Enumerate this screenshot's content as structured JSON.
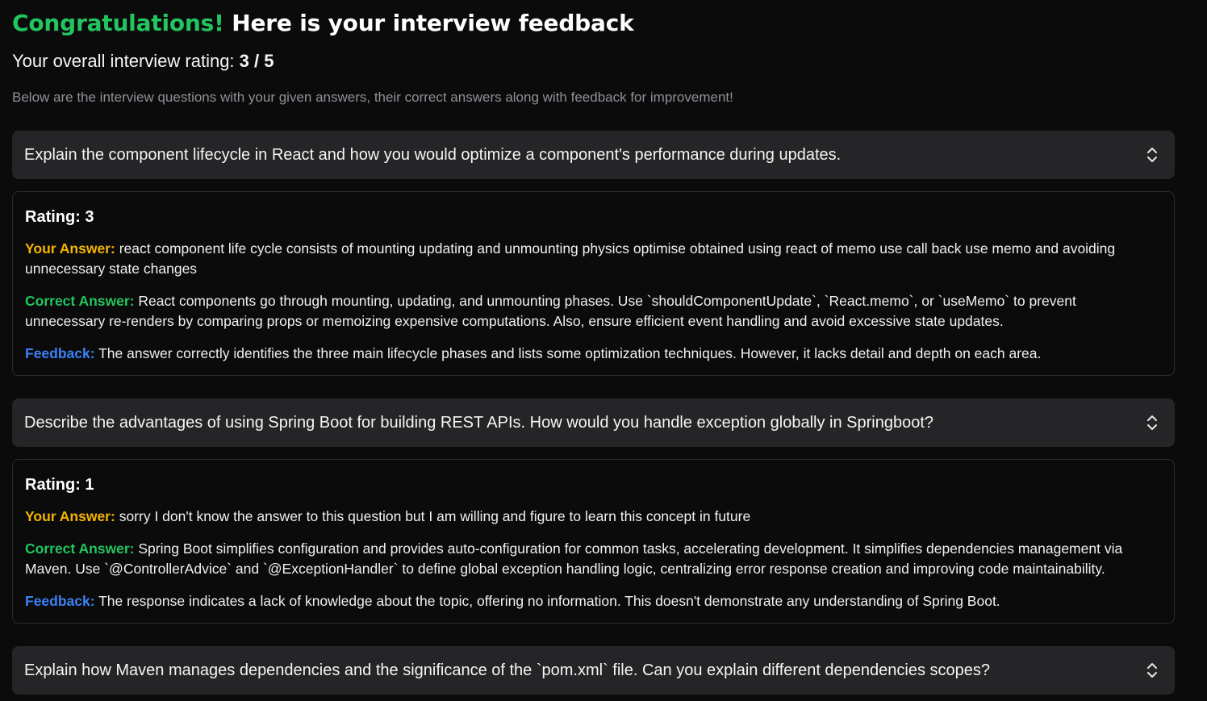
{
  "header": {
    "congrats": "Congratulations!",
    "title_rest": " Here is your interview feedback",
    "overall_label": "Your overall interview rating: ",
    "overall_score": "3 / 5",
    "intro": "Below are the interview questions with your given answers, their correct answers along with feedback for improvement!"
  },
  "labels": {
    "your_answer": "Your Answer:",
    "correct_answer": "Correct Answer:",
    "feedback": "Feedback:"
  },
  "colors": {
    "congrats": "#22c55e",
    "your_answer": "#f5b400",
    "correct_answer": "#22c55e",
    "feedback": "#3b82f6",
    "question_bar": "#252527"
  },
  "questions": [
    {
      "question": "Explain the component lifecycle in React and how you would optimize a component's performance during updates.",
      "expanded": true,
      "rating": "Rating: 3",
      "your_answer": "react component life cycle consists of mounting updating and unmounting physics optimise obtained using react of memo use call back use memo and avoiding unnecessary state changes",
      "correct_answer": "React components go through mounting, updating, and unmounting phases. Use `shouldComponentUpdate`, `React.memo`, or `useMemo` to prevent unnecessary re-renders by comparing props or memoizing expensive computations. Also, ensure efficient event handling and avoid excessive state updates.",
      "feedback": "The answer correctly identifies the three main lifecycle phases and lists some optimization techniques. However, it lacks detail and depth on each area."
    },
    {
      "question": "Describe the advantages of using Spring Boot for building REST APIs. How would you handle exception globally in Springboot?",
      "expanded": true,
      "rating": "Rating: 1",
      "your_answer": "sorry I don't know the answer to this question but I am willing and figure to learn this concept in future",
      "correct_answer": "Spring Boot simplifies configuration and provides auto-configuration for common tasks, accelerating development. It simplifies dependencies management via Maven. Use `@ControllerAdvice` and `@ExceptionHandler` to define global exception handling logic, centralizing error response creation and improving code maintainability.",
      "feedback": "The response indicates a lack of knowledge about the topic, offering no information. This doesn't demonstrate any understanding of Spring Boot."
    },
    {
      "question": "Explain how Maven manages dependencies and the significance of the `pom.xml` file. Can you explain different dependencies scopes?",
      "expanded": false
    }
  ],
  "icons": {
    "expand_toggle": "chevron-up-down-icon"
  }
}
